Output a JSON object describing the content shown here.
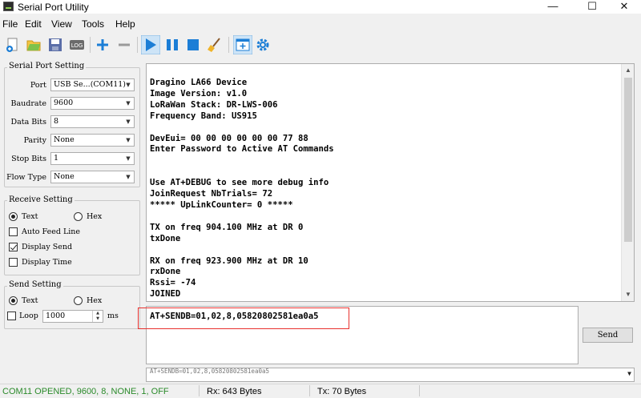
{
  "window": {
    "title": "Serial Port Utility",
    "minimize": "—",
    "maximize": "☐",
    "close": "✕"
  },
  "menu": [
    "File",
    "Edit",
    "View",
    "Tools",
    "Help"
  ],
  "serial_setting": {
    "title": "Serial Port Setting",
    "rows": [
      {
        "label": "Port",
        "value": "USB Se...(COM11)"
      },
      {
        "label": "Baudrate",
        "value": "9600"
      },
      {
        "label": "Data Bits",
        "value": "8"
      },
      {
        "label": "Parity",
        "value": "None"
      },
      {
        "label": "Stop Bits",
        "value": "1"
      },
      {
        "label": "Flow Type",
        "value": "None"
      }
    ]
  },
  "receive_setting": {
    "title": "Receive Setting",
    "text_label": "Text",
    "hex_label": "Hex",
    "auto_feed_line": "Auto Feed Line",
    "display_send": "Display Send",
    "display_time": "Display Time"
  },
  "send_setting": {
    "title": "Send Setting",
    "text_label": "Text",
    "hex_label": "Hex",
    "loop_label": "Loop",
    "loop_value": "1000",
    "unit": "ms"
  },
  "output_lines": [
    "Dragino LA66 Device",
    "Image Version: v1.0",
    "LoRaWan Stack: DR-LWS-006",
    "Frequency Band: US915",
    "",
    "DevEui= 00 00 00 00 00 00 77 88",
    "Enter Password to Active AT Commands",
    "",
    "",
    "Use AT+DEBUG to see more debug info",
    "JoinRequest NbTrials= 72",
    "***** UpLinkCounter= 0 *****",
    "",
    "TX on freq 904.100 MHz at DR 0",
    "txDone",
    "",
    "RX on freq 923.900 MHz at DR 10",
    "rxDone",
    "Rssi= -74",
    "JOINED"
  ],
  "send_text": "AT+SENDB=01,02,8,05820802581ea0a5",
  "send_button": "Send",
  "history_text": "AT+SENDB=01,02,8,05820802581ea0a5",
  "status": {
    "port": "COM11 OPENED, 9600, 8, NONE, 1, OFF",
    "rx": "Rx: 643 Bytes",
    "tx": "Tx: 70 Bytes"
  },
  "colors": {
    "status_port": "#2a8a2a",
    "highlight": "#e8312e",
    "play_blue": "#1c7ed6"
  }
}
